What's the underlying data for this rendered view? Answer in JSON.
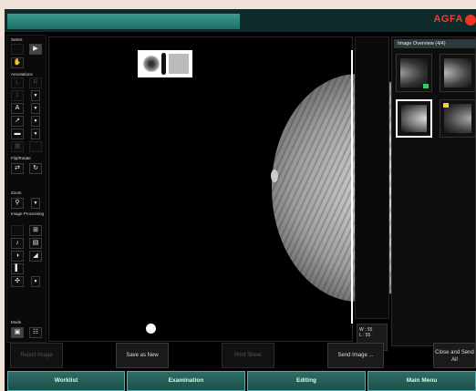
{
  "app": {
    "brand": "AGFA"
  },
  "toolbar": {
    "sections": {
      "select": "Select",
      "annotations": "Annotations",
      "flip_rotate": "Flip/Rotate",
      "zoom": "Zoom",
      "image_processing": "Image Processing",
      "mode": "Mode"
    }
  },
  "overview": {
    "title": "Image Overview (4/4)"
  },
  "window_level": {
    "w": "W : 55",
    "l": "L : 55"
  },
  "actions": {
    "reject": "Reject Image",
    "save_new": "Save as New",
    "print_sheet": "Print Sheet",
    "send_image": "Send Image ...",
    "close_send_l1": "Close and Send",
    "close_send_l2": "All"
  },
  "nav": {
    "worklist": "Worklist",
    "examination": "Examination",
    "editing": "Editing",
    "main_menu": "Main Menu"
  },
  "colors": {
    "accent": "#2e6e68",
    "brand": "#f23b3b"
  }
}
